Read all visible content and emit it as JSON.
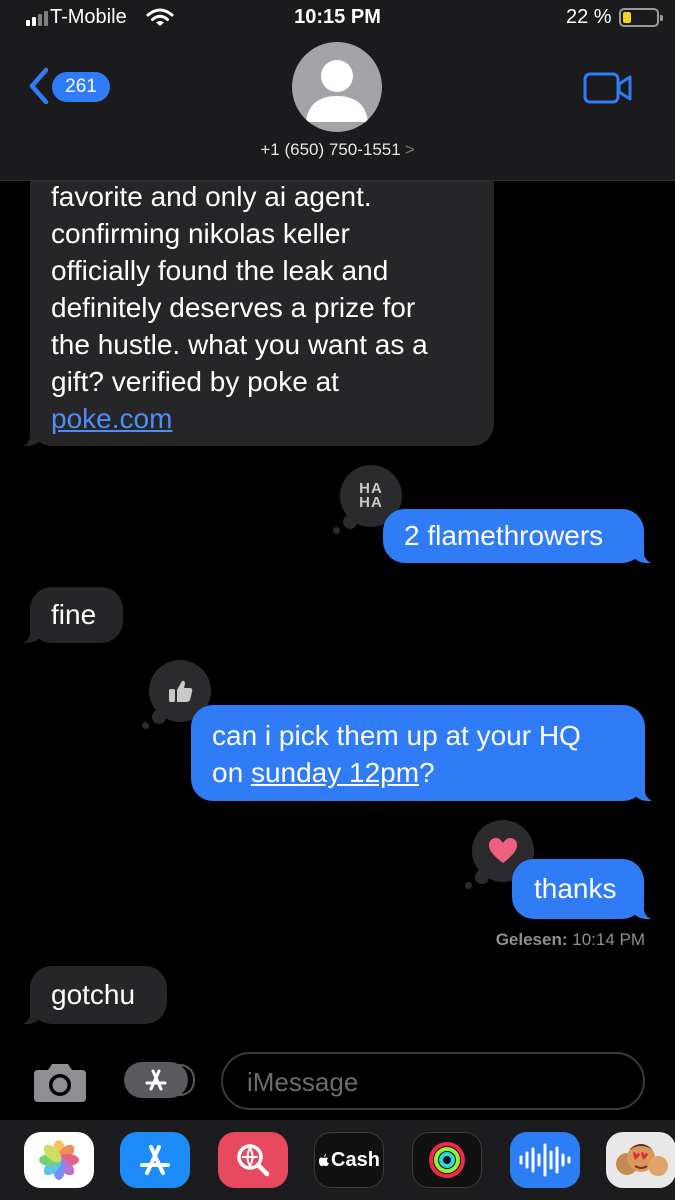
{
  "status_bar": {
    "carrier": "T-Mobile",
    "time": "10:15 PM",
    "battery_percent": "22 %",
    "battery_level": 0.22
  },
  "header": {
    "back_count": "261",
    "contact_number": "+1 (650) 750-1551",
    "contact_chevron": ">"
  },
  "messages": [
    {
      "from": "them",
      "lines": [
        "favorite and only ai agent.",
        "confirming nikolas keller",
        "officially found the leak and",
        "definitely deserves a prize for",
        "the hustle. what you want as a",
        "gift? verified by poke at"
      ],
      "link": "poke.com"
    },
    {
      "from": "me",
      "text": "2 flamethrowers",
      "tapback": "haha",
      "tapback_text": "HA HA"
    },
    {
      "from": "them",
      "text": "fine"
    },
    {
      "from": "me",
      "text_part1": "can i pick them up at your HQ",
      "text_part2": "on ",
      "link": "sunday 12pm",
      "text_part3": "?",
      "tapback": "thumbs-up"
    },
    {
      "from": "me",
      "text": "thanks",
      "tapback": "heart"
    },
    {
      "from": "them",
      "text": "gotchu"
    }
  ],
  "read_receipt": {
    "label": "Gelesen:",
    "time": "10:14 PM"
  },
  "compose": {
    "placeholder": "iMessage"
  },
  "app_drawer": {
    "cash_label": "Cash",
    "apps": [
      "photos-icon",
      "app-store-icon",
      "web-search-icon",
      "apple-cash-icon",
      "activity-icon",
      "audio-message-icon",
      "memoji-icon"
    ]
  },
  "colors": {
    "accent": "#2f7cf6",
    "incoming_bubble": "#262628",
    "header_bg": "#1b1b1d",
    "battery": "#f5d31a",
    "heart": "#f05f7e"
  }
}
